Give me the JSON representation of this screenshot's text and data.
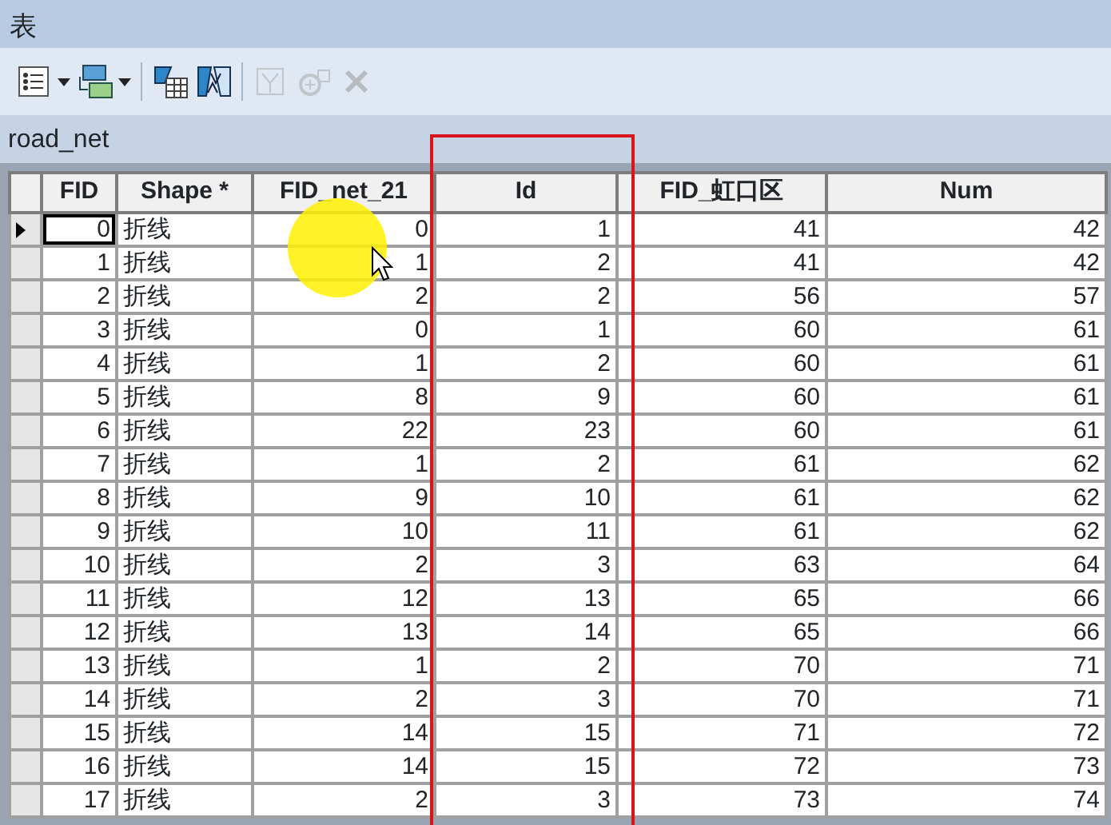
{
  "window": {
    "title": "表"
  },
  "toolbar": [
    {
      "kind": "table-options",
      "dropdown": true,
      "disabled": false
    },
    {
      "kind": "related-tables",
      "dropdown": true,
      "disabled": false
    },
    {
      "kind": "select-by-attributes",
      "dropdown": false,
      "disabled": false
    },
    {
      "kind": "switch-selection",
      "dropdown": false,
      "disabled": false
    },
    {
      "kind": "clear-selection",
      "dropdown": false,
      "disabled": true
    },
    {
      "kind": "zoom-to-selected",
      "dropdown": false,
      "disabled": true
    },
    {
      "kind": "delete",
      "dropdown": false,
      "disabled": true
    }
  ],
  "table": {
    "name": "road_net",
    "columns": [
      {
        "label": "FID",
        "kind": "number"
      },
      {
        "label": "Shape *",
        "kind": "text"
      },
      {
        "label": "FID_net_21",
        "kind": "number"
      },
      {
        "label": "Id",
        "kind": "number"
      },
      {
        "label": "FID_虹口区",
        "kind": "number"
      },
      {
        "label": "Num",
        "kind": "number"
      }
    ],
    "rows": [
      {
        "current": true,
        "cells": [
          "0",
          "折线",
          "0",
          "1",
          "41",
          "42"
        ]
      },
      {
        "current": false,
        "cells": [
          "1",
          "折线",
          "1",
          "2",
          "41",
          "42"
        ]
      },
      {
        "current": false,
        "cells": [
          "2",
          "折线",
          "2",
          "2",
          "56",
          "57"
        ]
      },
      {
        "current": false,
        "cells": [
          "3",
          "折线",
          "0",
          "1",
          "60",
          "61"
        ]
      },
      {
        "current": false,
        "cells": [
          "4",
          "折线",
          "1",
          "2",
          "60",
          "61"
        ]
      },
      {
        "current": false,
        "cells": [
          "5",
          "折线",
          "8",
          "9",
          "60",
          "61"
        ]
      },
      {
        "current": false,
        "cells": [
          "6",
          "折线",
          "22",
          "23",
          "60",
          "61"
        ]
      },
      {
        "current": false,
        "cells": [
          "7",
          "折线",
          "1",
          "2",
          "61",
          "62"
        ]
      },
      {
        "current": false,
        "cells": [
          "8",
          "折线",
          "9",
          "10",
          "61",
          "62"
        ]
      },
      {
        "current": false,
        "cells": [
          "9",
          "折线",
          "10",
          "11",
          "61",
          "62"
        ]
      },
      {
        "current": false,
        "cells": [
          "10",
          "折线",
          "2",
          "3",
          "63",
          "64"
        ]
      },
      {
        "current": false,
        "cells": [
          "11",
          "折线",
          "12",
          "13",
          "65",
          "66"
        ]
      },
      {
        "current": false,
        "cells": [
          "12",
          "折线",
          "13",
          "14",
          "65",
          "66"
        ]
      },
      {
        "current": false,
        "cells": [
          "13",
          "折线",
          "1",
          "2",
          "70",
          "71"
        ]
      },
      {
        "current": false,
        "cells": [
          "14",
          "折线",
          "2",
          "3",
          "70",
          "71"
        ]
      },
      {
        "current": false,
        "cells": [
          "15",
          "折线",
          "14",
          "15",
          "71",
          "72"
        ]
      },
      {
        "current": false,
        "cells": [
          "16",
          "折线",
          "14",
          "15",
          "72",
          "73"
        ]
      },
      {
        "current": false,
        "cells": [
          "17",
          "折线",
          "2",
          "3",
          "73",
          "74"
        ]
      }
    ]
  }
}
